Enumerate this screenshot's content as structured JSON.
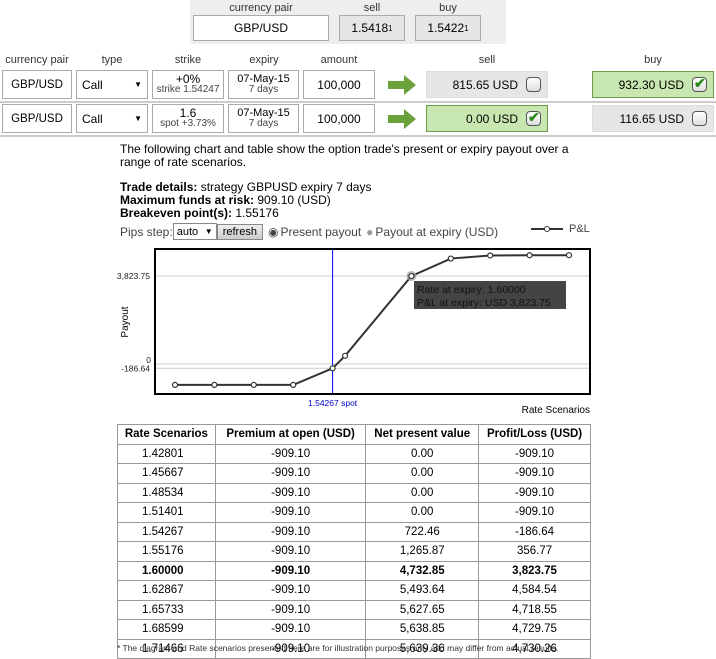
{
  "quote": {
    "pair_label": "currency pair",
    "sell_label": "sell",
    "buy_label": "buy",
    "pair": "GBP/USD",
    "sell": "1.5418",
    "sell_pip": "1",
    "buy": "1.5422",
    "buy_pip": "1"
  },
  "columns": {
    "pair": "currency pair",
    "type": "type",
    "strike": "strike",
    "expiry": "expiry",
    "amount": "amount",
    "sell": "sell",
    "buy": "buy"
  },
  "legs": [
    {
      "pair": "GBP/USD",
      "type": "Call",
      "strike_main": "+0%",
      "strike_sub": "strike 1.54247",
      "expiry": "07-May-15",
      "tenor": "7 days",
      "amount": "100,000",
      "sell": "815.65 USD",
      "sell_checked": false,
      "buy": "932.30 USD",
      "buy_checked": true
    },
    {
      "pair": "GBP/USD",
      "type": "Call",
      "strike_main": "1.6",
      "strike_sub": "spot +3.73%",
      "expiry": "07-May-15",
      "tenor": "7 days",
      "amount": "100,000",
      "sell": "0.00 USD",
      "sell_checked": true,
      "buy": "116.65 USD",
      "buy_checked": false
    }
  ],
  "intro": "The following chart and table show the option trade's present or expiry payout over a range of rate scenarios.",
  "details": {
    "trade_label": "Trade details:",
    "trade": " strategy GBPUSD expiry 7 days",
    "risk_label": "Maximum funds at risk:",
    "risk": " 909.10 (USD)",
    "be_label": "Breakeven point(s):",
    "be": " 1.55176"
  },
  "controls": {
    "pips_label": "Pips step:",
    "pips_value": "auto",
    "refresh": "refresh",
    "radio1": "Present payout",
    "radio2": "Payout at expiry (USD)",
    "radio_selected": "Present payout"
  },
  "colors": {
    "green_selected": "#c8e6b0",
    "arrow": "#6aa13a",
    "spot_line": "#0000ff"
  },
  "chart_data": {
    "type": "line",
    "legend": "P&L",
    "legend_placement": "top-right",
    "ylabel": "Payout",
    "xlabel": "Rate Scenarios",
    "yticks": [
      "3,823.75",
      "0",
      "-186.64"
    ],
    "spot_label": "1.54267 spot",
    "spot": 1.54267,
    "x": [
      1.42801,
      1.45667,
      1.48534,
      1.51401,
      1.54267,
      1.55176,
      1.6,
      1.62867,
      1.65733,
      1.68599,
      1.71466
    ],
    "y": [
      -909.1,
      -909.1,
      -909.1,
      -909.1,
      -186.64,
      356.77,
      3823.75,
      4584.54,
      4718.55,
      4729.75,
      4730.26
    ],
    "tooltip": {
      "line1": "Rate at expiry: 1.60000",
      "line2": "P&L at expiry: USD 3,823.75"
    }
  },
  "table": {
    "headers": [
      "Rate Scenarios",
      "Premium at open (USD)",
      "Net present value",
      "Profit/Loss (USD)"
    ],
    "rows": [
      [
        "1.42801",
        "-909.10",
        "0.00",
        "-909.10"
      ],
      [
        "1.45667",
        "-909.10",
        "0.00",
        "-909.10"
      ],
      [
        "1.48534",
        "-909.10",
        "0.00",
        "-909.10"
      ],
      [
        "1.51401",
        "-909.10",
        "0.00",
        "-909.10"
      ],
      [
        "1.54267",
        "-909.10",
        "722.46",
        "-186.64"
      ],
      [
        "1.55176",
        "-909.10",
        "1,265.87",
        "356.77"
      ],
      [
        "1.60000",
        "-909.10",
        "4,732.85",
        "3,823.75"
      ],
      [
        "1.62867",
        "-909.10",
        "5,493.64",
        "4,584.54"
      ],
      [
        "1.65733",
        "-909.10",
        "5,627.65",
        "4,718.55"
      ],
      [
        "1.68599",
        "-909.10",
        "5,638.85",
        "4,729.75"
      ],
      [
        "1.71466",
        "-909.10",
        "5,639.36",
        "4,730.26"
      ]
    ],
    "bold_row": 6
  },
  "footnote": "* The diagram and Rate scenarios presented here are for illustration purposes only and may differ from actual results."
}
